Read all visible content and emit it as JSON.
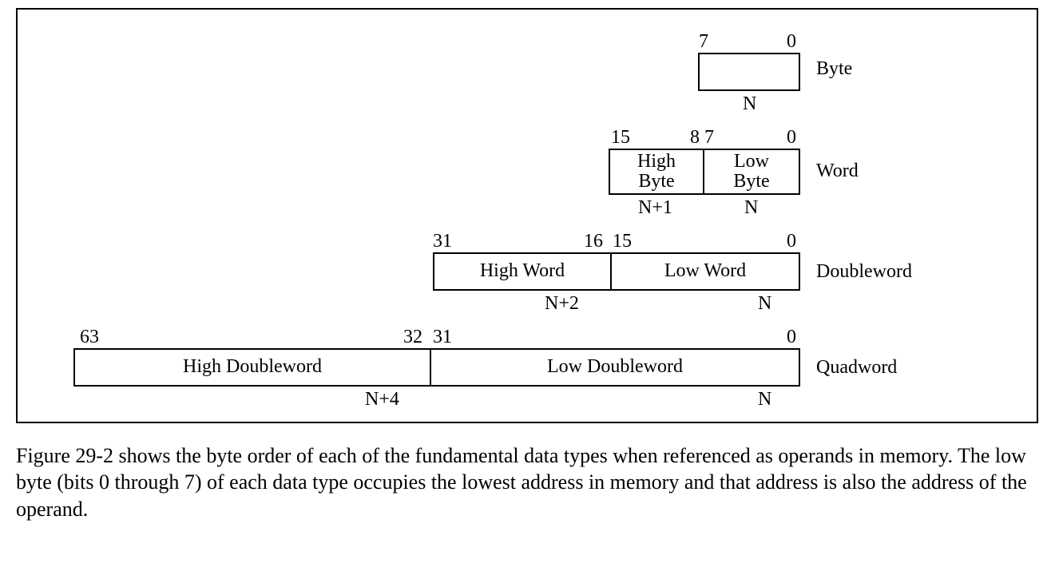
{
  "byte": {
    "bit_hi": "7",
    "bit_lo": "0",
    "label": "Byte",
    "addr": "N"
  },
  "word": {
    "bits": {
      "b15": "15",
      "b8": "8",
      "b7": "7",
      "b0": "0"
    },
    "high": "High\nByte",
    "low": "Low\nByte",
    "label": "Word",
    "addr_high": "N+1",
    "addr_low": "N"
  },
  "dword": {
    "bits": {
      "b31": "31",
      "b16": "16",
      "b15": "15",
      "b0": "0"
    },
    "high": "High Word",
    "low": "Low Word",
    "label": "Doubleword",
    "addr_high": "N+2",
    "addr_low": "N"
  },
  "qword": {
    "bits": {
      "b63": "63",
      "b32": "32",
      "b31": "31",
      "b0": "0"
    },
    "high": "High Doubleword",
    "low": "Low Doubleword",
    "label": "Quadword",
    "addr_high": "N+4",
    "addr_low": "N"
  },
  "caption": "Figure 29-2 shows the byte order of each of the fundamental data types when referenced as operands in memory. The low byte (bits 0 through 7) of each data type occupies the lowest address in memory and that address is also the address of the operand."
}
